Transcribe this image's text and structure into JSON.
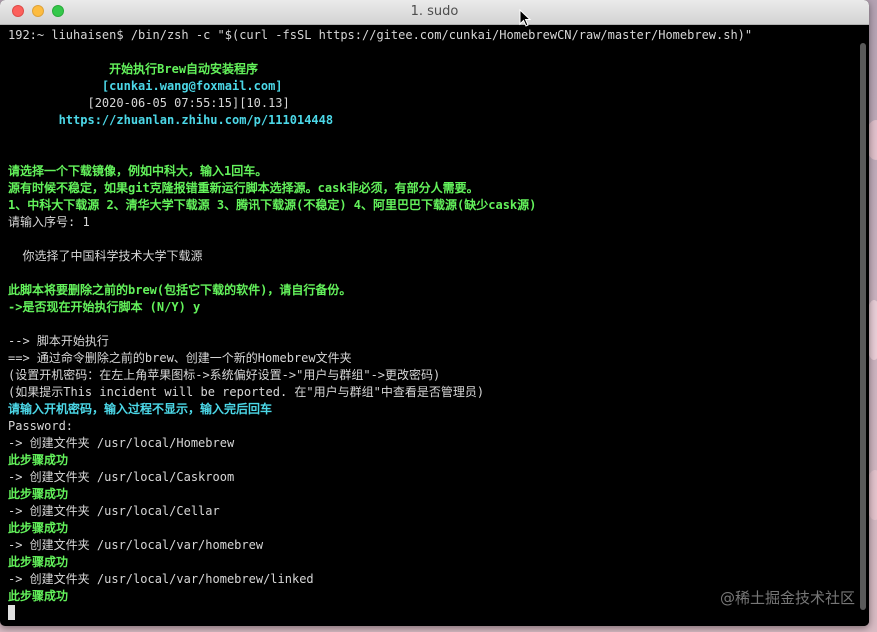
{
  "window": {
    "title": "1. sudo"
  },
  "terminal": {
    "lines": [
      {
        "text": "192:~ liuhaisen$ /bin/zsh -c \"$(curl -fsSL https://gitee.com/cunkai/HomebrewCN/raw/master/Homebrew.sh)\"",
        "style": "white"
      },
      {
        "text": "",
        "style": "white"
      },
      {
        "text": "              开始执行Brew自动安装程序",
        "style": "green"
      },
      {
        "text": "             [cunkai.wang@foxmail.com]",
        "style": "cyan"
      },
      {
        "text": "           [2020-06-05 07:55:15][10.13]",
        "style": "white"
      },
      {
        "text": "       https://zhuanlan.zhihu.com/p/111014448",
        "style": "cyan"
      },
      {
        "text": "",
        "style": "white"
      },
      {
        "text": "",
        "style": "white"
      },
      {
        "text": "请选择一个下载镜像，例如中科大，输入1回车。",
        "style": "green"
      },
      {
        "text": "源有时候不稳定，如果git克隆报错重新运行脚本选择源。cask非必须，有部分人需要。",
        "style": "green"
      },
      {
        "text": "1、中科大下载源 2、清华大学下载源 3、腾讯下载源(不稳定) 4、阿里巴巴下载源(缺少cask源)",
        "style": "green"
      },
      {
        "text": "请输入序号: 1",
        "style": "white"
      },
      {
        "text": "",
        "style": "white"
      },
      {
        "text": "  你选择了中国科学技术大学下载源",
        "style": "white"
      },
      {
        "text": "",
        "style": "white"
      },
      {
        "text": "此脚本将要删除之前的brew(包括它下载的软件)，请自行备份。",
        "style": "green"
      },
      {
        "text": "->是否现在开始执行脚本 (N/Y) y",
        "style": "green"
      },
      {
        "text": "",
        "style": "white"
      },
      {
        "text": "--> 脚本开始执行",
        "style": "white"
      },
      {
        "text": "==> 通过命令删除之前的brew、创建一个新的Homebrew文件夹",
        "style": "white"
      },
      {
        "text": "(设置开机密码：在左上角苹果图标->系统偏好设置->\"用户与群组\"->更改密码)",
        "style": "white"
      },
      {
        "text": "(如果提示This incident will be reported. 在\"用户与群组\"中查看是否管理员)",
        "style": "white"
      },
      {
        "text": "请输入开机密码，输入过程不显示，输入完后回车",
        "style": "cyan"
      },
      {
        "text": "Password:",
        "style": "white"
      },
      {
        "text": "-> 创建文件夹 /usr/local/Homebrew",
        "style": "white"
      },
      {
        "text": "此步骤成功",
        "style": "green"
      },
      {
        "text": "-> 创建文件夹 /usr/local/Caskroom",
        "style": "white"
      },
      {
        "text": "此步骤成功",
        "style": "green"
      },
      {
        "text": "-> 创建文件夹 /usr/local/Cellar",
        "style": "white"
      },
      {
        "text": "此步骤成功",
        "style": "green"
      },
      {
        "text": "-> 创建文件夹 /usr/local/var/homebrew",
        "style": "white"
      },
      {
        "text": "此步骤成功",
        "style": "green"
      },
      {
        "text": "-> 创建文件夹 /usr/local/var/homebrew/linked",
        "style": "white"
      },
      {
        "text": "此步骤成功",
        "style": "green"
      }
    ]
  },
  "watermark": {
    "text": "@稀土掘金技术社区"
  },
  "colors": {
    "white_text": "#d7d7d7",
    "green_text": "#63f25b",
    "cyan_text": "#4cd8e8",
    "background": "#000000"
  },
  "icons": {
    "close": "close-traffic-light-icon",
    "minimize": "minimize-traffic-light-icon",
    "zoom": "zoom-traffic-light-icon",
    "pointer": "mouse-pointer-icon"
  }
}
